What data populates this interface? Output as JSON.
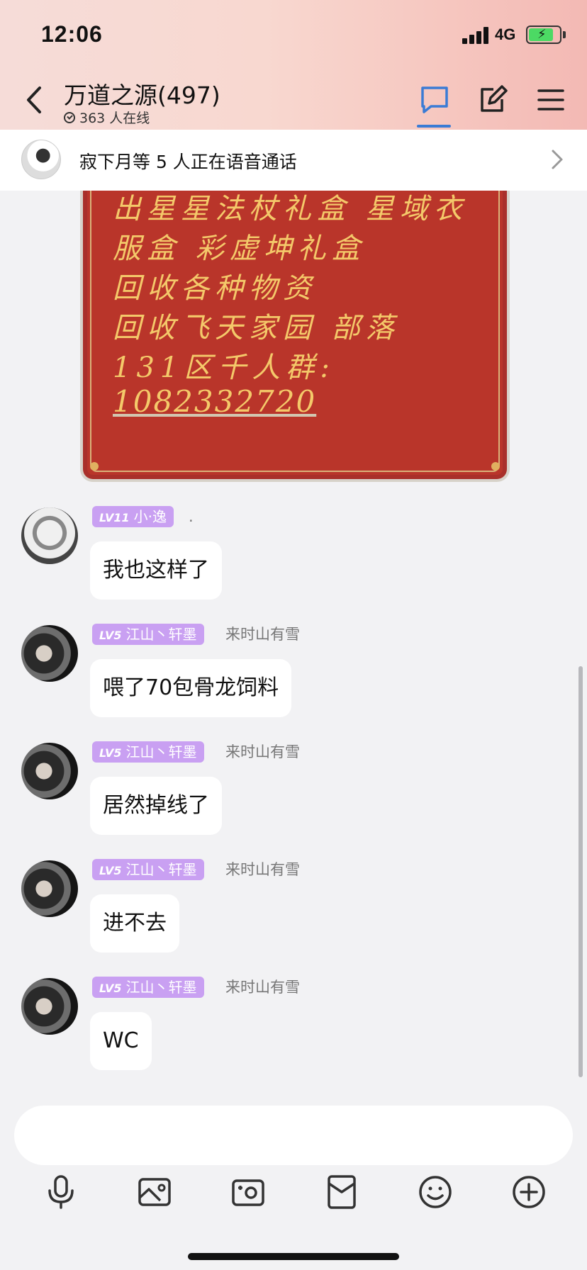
{
  "status_bar": {
    "time": "12:06",
    "network": "4G",
    "battery_charging": true
  },
  "header": {
    "title": "万道之源(497)",
    "online_text": "363 人在线",
    "accent_color": "#3a7bd5"
  },
  "voice_banner": {
    "text": "寂下月等 5 人正在语音通话"
  },
  "image_card": {
    "lines": [
      "出星星法杖礼盒 星域衣",
      "服盒 彩虚坤礼盒",
      "回收各种物资",
      "回收飞天家园 部落",
      "131区千人群:",
      "1082332720"
    ]
  },
  "messages": [
    {
      "level": "LV11",
      "badge_name": "小·逸",
      "nickname": ".",
      "text": "我也这样了"
    },
    {
      "level": "LV5",
      "badge_name": "江山丶轩墨",
      "nickname": "来时山有雪",
      "text": "喂了70包骨龙饲料"
    },
    {
      "level": "LV5",
      "badge_name": "江山丶轩墨",
      "nickname": "来时山有雪",
      "text": "居然掉线了"
    },
    {
      "level": "LV5",
      "badge_name": "江山丶轩墨",
      "nickname": "来时山有雪",
      "text": "进不去"
    },
    {
      "level": "LV5",
      "badge_name": "江山丶轩墨",
      "nickname": "来时山有雪",
      "text": "WC"
    }
  ],
  "toolbar": {
    "icons": [
      "microphone-icon",
      "image-icon",
      "camera-icon",
      "red-packet-icon",
      "emoji-icon",
      "plus-icon"
    ]
  }
}
